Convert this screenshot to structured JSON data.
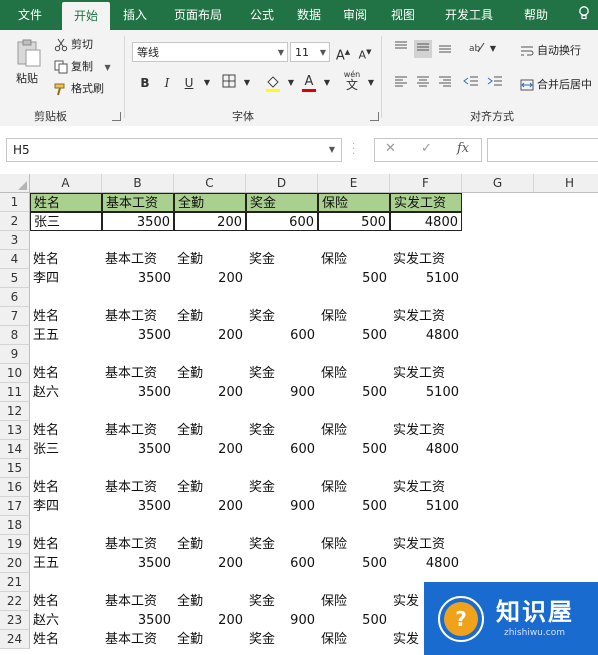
{
  "ribbon_tabs": [
    "文件",
    "开始",
    "插入",
    "页面布局",
    "公式",
    "数据",
    "审阅",
    "视图",
    "开发工具",
    "帮助"
  ],
  "active_tab": "开始",
  "clipboard": {
    "paste_label": "粘贴",
    "cut_label": "剪切",
    "copy_label": "复制",
    "format_painter_label": "格式刷",
    "group_label": "剪贴板"
  },
  "font": {
    "font_name": "等线",
    "font_size": "11",
    "grow_label": "A",
    "shrink_label": "A",
    "bold": "B",
    "italic": "I",
    "underline": "U",
    "font_color_label": "A",
    "phonetic_label": "wén",
    "phonetic_char": "文",
    "group_label": "字体"
  },
  "alignment": {
    "wrap_text_label": "自动换行",
    "merge_center_label": "合并后居中",
    "group_label": "对齐方式"
  },
  "formula_bar": {
    "name_box": "H5",
    "fx": "fx",
    "formula": ""
  },
  "columns": [
    "A",
    "B",
    "C",
    "D",
    "E",
    "F",
    "G",
    "H"
  ],
  "rows": [
    "1",
    "2",
    "3",
    "4",
    "5",
    "6",
    "7",
    "8",
    "9",
    "10",
    "11",
    "12",
    "13",
    "14",
    "15",
    "16",
    "17",
    "18",
    "19",
    "20",
    "21",
    "22",
    "23",
    "24"
  ],
  "header_row": [
    "姓名",
    "基本工资",
    "全勤",
    "奖金",
    "保险",
    "实发工资"
  ],
  "records": [
    {
      "name": "张三",
      "base": "3500",
      "attendance": "200",
      "bonus": "600",
      "insurance": "500",
      "net": "4800"
    },
    {
      "name": "李四",
      "base": "3500",
      "attendance": "200",
      "bonus": "",
      "insurance": "500",
      "net": "5100"
    },
    {
      "name": "王五",
      "base": "3500",
      "attendance": "200",
      "bonus": "600",
      "insurance": "500",
      "net": "4800"
    },
    {
      "name": "赵六",
      "base": "3500",
      "attendance": "200",
      "bonus": "900",
      "insurance": "500",
      "net": "5100"
    },
    {
      "name": "张三",
      "base": "3500",
      "attendance": "200",
      "bonus": "600",
      "insurance": "500",
      "net": "4800"
    },
    {
      "name": "李四",
      "base": "3500",
      "attendance": "200",
      "bonus": "900",
      "insurance": "500",
      "net": "5100"
    },
    {
      "name": "王五",
      "base": "3500",
      "attendance": "200",
      "bonus": "600",
      "insurance": "500",
      "net": "4800"
    },
    {
      "name": "赵六",
      "base": "3500",
      "attendance": "200",
      "bonus": "900",
      "insurance": "500",
      "net": ""
    }
  ],
  "partial_row_24": [
    "姓名",
    "基本工资",
    "全勤",
    "奖金",
    "保险",
    "实发"
  ],
  "colors": {
    "ribbon_green": "#217346",
    "header_fill": "#a9d08e",
    "watermark_blue": "#1a6bd0"
  },
  "watermark": {
    "title": "知识屋",
    "url": "zhishiwu.com"
  }
}
